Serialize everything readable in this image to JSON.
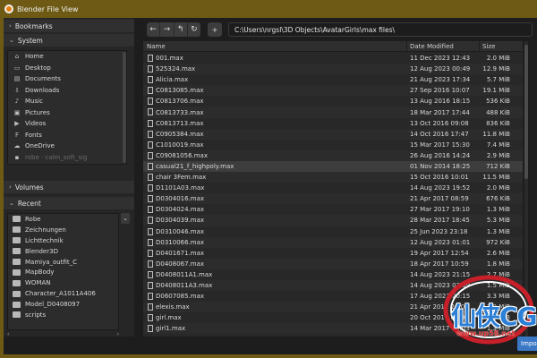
{
  "window": {
    "title": "Blender File View"
  },
  "sidebar": {
    "bookmarks_label": "Bookmarks",
    "system_label": "System",
    "system_items": [
      {
        "label": "Home",
        "icon": "home-icon",
        "glyph": "⌂"
      },
      {
        "label": "Desktop",
        "icon": "desktop-icon",
        "glyph": "▭"
      },
      {
        "label": "Documents",
        "icon": "documents-icon",
        "glyph": "▤"
      },
      {
        "label": "Downloads",
        "icon": "downloads-icon",
        "glyph": "⇩"
      },
      {
        "label": "Music",
        "icon": "music-icon",
        "glyph": "♪"
      },
      {
        "label": "Pictures",
        "icon": "pictures-icon",
        "glyph": "▣"
      },
      {
        "label": "Videos",
        "icon": "videos-icon",
        "glyph": "▶"
      },
      {
        "label": "Fonts",
        "icon": "fonts-icon",
        "glyph": "F"
      },
      {
        "label": "OneDrive",
        "icon": "onedrive-icon",
        "glyph": "☁"
      },
      {
        "label": "robe · calm_soft_sig",
        "icon": "folder-icon",
        "glyph": "▪"
      }
    ],
    "volumes_label": "Volumes",
    "recent_label": "Recent",
    "recent_items": [
      "Robe",
      "Zeichnungen",
      "Lichttechnik",
      "Blender3D",
      "Mamiya_outfit_C",
      "MapBody",
      "WOMAN",
      "Character_A1011A406",
      "Model_D0408097",
      "scripts"
    ]
  },
  "toolbar": {
    "back": "←",
    "forward": "→",
    "parent": "↰",
    "refresh": "↻",
    "new_dir": "+",
    "path": "C:\\Users\\nrgsl\\3D Objects\\AvatarGirls\\max files\\"
  },
  "columns": {
    "name": "Name",
    "date": "Date Modified",
    "size": "Size"
  },
  "files": [
    {
      "name": "001.max",
      "date": "11 Dec 2023 12:43",
      "size": "2.0 MiB"
    },
    {
      "name": "525324.max",
      "date": "12 Aug 2023 00:49",
      "size": "12.9 MiB"
    },
    {
      "name": "Alicia.max",
      "date": "21 Aug 2023 17:34",
      "size": "5.7 MiB"
    },
    {
      "name": "C0813085.max",
      "date": "27 Sep 2016 10:07",
      "size": "19.1 MiB"
    },
    {
      "name": "C0813706.max",
      "date": "13 Aug 2016 18:15",
      "size": "536 KiB"
    },
    {
      "name": "C0813733.max",
      "date": "18 Mar 2017 17:44",
      "size": "488 KiB"
    },
    {
      "name": "C0813713.max",
      "date": "13 Oct 2016 09:08",
      "size": "836 KiB"
    },
    {
      "name": "C0905384.max",
      "date": "14 Oct 2016 17:47",
      "size": "11.8 MiB"
    },
    {
      "name": "C1010019.max",
      "date": "15 Mar 2017 15:30",
      "size": "7.4 MiB"
    },
    {
      "name": "C09081056.max",
      "date": "26 Aug 2016 14:24",
      "size": "2.9 MiB"
    },
    {
      "name": "casual21_f_highpoly.max",
      "date": "01 Nov 2014 18:25",
      "size": "712 KiB"
    },
    {
      "name": "chair 3Fem.max",
      "date": "15 Oct 2016 10:01",
      "size": "11.5 MiB"
    },
    {
      "name": "D1101A03.max",
      "date": "14 Aug 2023 19:52",
      "size": "2.0 MiB"
    },
    {
      "name": "D0304016.max",
      "date": "21 Apr 2017 08:59",
      "size": "676 KiB"
    },
    {
      "name": "D0304024.max",
      "date": "27 Mar 2017 19:10",
      "size": "1.3 MiB"
    },
    {
      "name": "D0304039.max",
      "date": "28 Mar 2017 18:45",
      "size": "5.3 MiB"
    },
    {
      "name": "D0310046.max",
      "date": "25 Jun 2023 23:18",
      "size": "1.3 MiB"
    },
    {
      "name": "D0310066.max",
      "date": "12 Aug 2023 01:01",
      "size": "972 KiB"
    },
    {
      "name": "D0401671.max",
      "date": "19 Apr 2017 12:54",
      "size": "2.6 MiB"
    },
    {
      "name": "D0408067.max",
      "date": "18 Apr 2017 10:59",
      "size": "1.8 MiB"
    },
    {
      "name": "D0408011A1.max",
      "date": "14 Aug 2023 21:15",
      "size": "2.7 MiB"
    },
    {
      "name": "D0408011A3.max",
      "date": "14 Aug 2023 03:59",
      "size": "1.5 MiB"
    },
    {
      "name": "D0607085.max",
      "date": "17 Aug 2023 20:15",
      "size": "3.3 MiB"
    },
    {
      "name": "elexis.max",
      "date": "21 Apr 2017 20:09",
      "size": "1.0 MiB"
    },
    {
      "name": "girl.max",
      "date": "20 Oct 2016 03:05",
      "size": "2.4 MiB"
    },
    {
      "name": "girl1.max",
      "date": "14 Mar 2017 20:03",
      "size": "1.3 MiB"
    }
  ],
  "selected_index": 10,
  "import_label": "Impo",
  "watermark": {
    "text": "仙侠CG",
    "url": "www.up58.net"
  },
  "colors": {
    "titlebar": "#6e5a14",
    "accent": "#3a78c5",
    "logo": "#e87d0d"
  }
}
